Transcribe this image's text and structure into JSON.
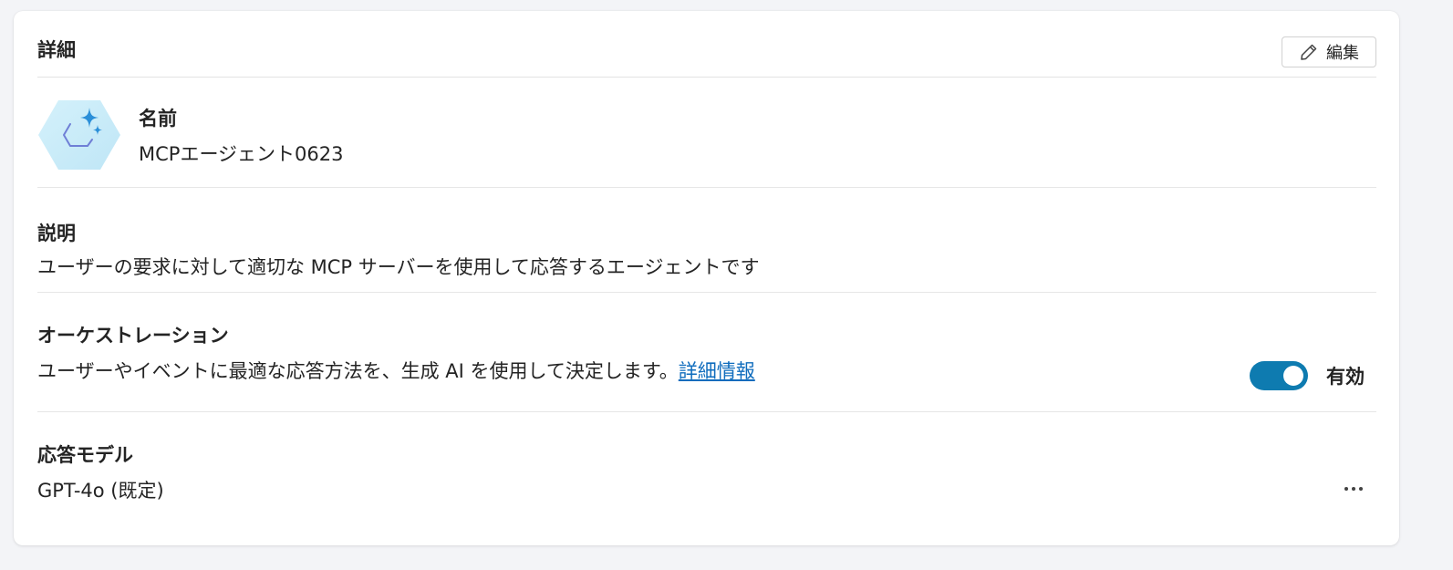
{
  "header": {
    "title": "詳細",
    "edit_label": "編集"
  },
  "name_section": {
    "label": "名前",
    "value": "MCPエージェント0623",
    "icon": "agent-hexagon-sparkle-icon"
  },
  "description_section": {
    "label": "説明",
    "value": "ユーザーの要求に対して適切な MCP サーバーを使用して応答するエージェントです"
  },
  "orchestration_section": {
    "label": "オーケストレーション",
    "description": "ユーザーやイベントに最適な応答方法を、生成 AI を使用して決定します。",
    "link_text": "詳細情報",
    "toggle_label": "有効",
    "toggle_on": true
  },
  "model_section": {
    "label": "応答モデル",
    "value": "GPT-4o (既定)",
    "more_icon": "more-horizontal-icon"
  },
  "colors": {
    "accent": "#0e7bb0",
    "link": "#0f6cbd",
    "text": "#242424"
  }
}
